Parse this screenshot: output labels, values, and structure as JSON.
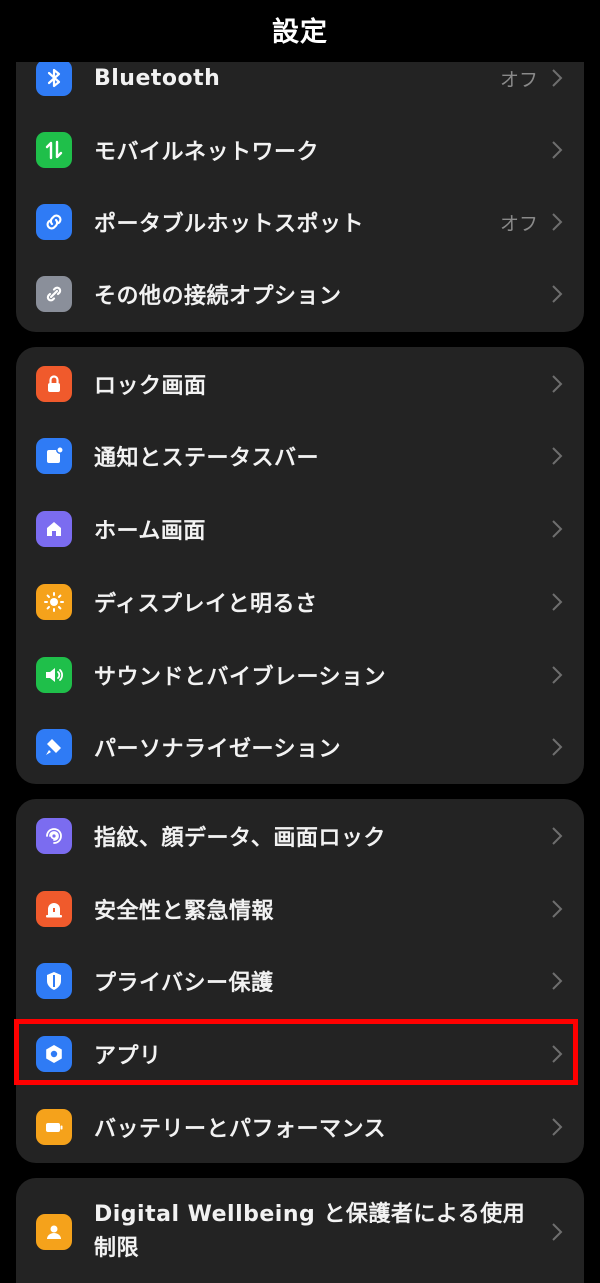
{
  "header": {
    "title": "設定"
  },
  "groups": [
    {
      "items": [
        {
          "label": "Bluetooth",
          "value": "オフ",
          "icon": "bluetooth-icon",
          "color": "#2f7bf5"
        },
        {
          "label": "モバイルネットワーク",
          "value": "",
          "icon": "mobile-data-icon",
          "color": "#1fbf4a"
        },
        {
          "label": "ポータブルホットスポット",
          "value": "オフ",
          "icon": "hotspot-link-icon",
          "color": "#2f7bf5"
        },
        {
          "label": "その他の接続オプション",
          "value": "",
          "icon": "connection-link-icon",
          "color": "#8a8f9a"
        }
      ]
    },
    {
      "items": [
        {
          "label": "ロック画面",
          "value": "",
          "icon": "lock-icon",
          "color": "#f05a2c"
        },
        {
          "label": "通知とステータスバー",
          "value": "",
          "icon": "notification-icon",
          "color": "#2f7bf5"
        },
        {
          "label": "ホーム画面",
          "value": "",
          "icon": "home-icon",
          "color": "#7b6cf0"
        },
        {
          "label": "ディスプレイと明るさ",
          "value": "",
          "icon": "brightness-icon",
          "color": "#f5a21b"
        },
        {
          "label": "サウンドとバイブレーション",
          "value": "",
          "icon": "sound-icon",
          "color": "#1fbf4a"
        },
        {
          "label": "パーソナライゼーション",
          "value": "",
          "icon": "personalization-icon",
          "color": "#2f7bf5"
        }
      ]
    },
    {
      "items": [
        {
          "label": "指紋、顔データ、画面ロック",
          "value": "",
          "icon": "fingerprint-icon",
          "color": "#7b6cf0"
        },
        {
          "label": "安全性と緊急情報",
          "value": "",
          "icon": "emergency-icon",
          "color": "#f05a2c"
        },
        {
          "label": "プライバシー保護",
          "value": "",
          "icon": "privacy-shield-icon",
          "color": "#2f7bf5"
        },
        {
          "label": "アプリ",
          "value": "",
          "icon": "apps-gear-icon",
          "color": "#2f7bf5"
        },
        {
          "label": "バッテリーとパフォーマンス",
          "value": "",
          "icon": "battery-icon",
          "color": "#f5a21b"
        }
      ]
    },
    {
      "items": [
        {
          "label": "Digital Wellbeing と保護者による使用制限",
          "value": "",
          "icon": "wellbeing-icon",
          "color": "#f5a21b"
        }
      ]
    }
  ],
  "highlight_color": "#ff0000"
}
